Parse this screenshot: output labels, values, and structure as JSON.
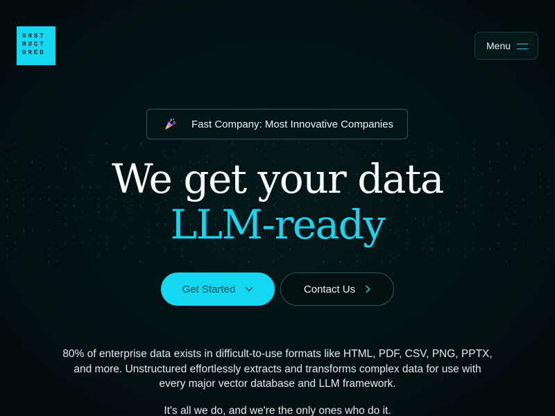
{
  "logo": {
    "lines": [
      "UNST",
      "RUCT",
      "URED"
    ]
  },
  "nav": {
    "menu_label": "Menu",
    "menu_icon": "hamburger-icon"
  },
  "announcement": {
    "icon": "party-popper-icon",
    "text": "Fast Company: Most Innovative Companies"
  },
  "hero": {
    "headline_line1": "We get your data",
    "headline_line2": "LLM-ready"
  },
  "actions": {
    "primary_label": "Get Started",
    "primary_icon": "chevron-down-icon",
    "secondary_label": "Contact Us",
    "secondary_icon": "chevron-right-icon"
  },
  "body": {
    "description": "80% of enterprise data exists in difficult-to-use formats like HTML, PDF, CSV, PNG, PPTX, and more. Unstructured effortlessly extracts and transforms complex data for use with every major vector database and LLM framework.",
    "tagline": "It's all we do, and we're the only ones who do it."
  },
  "colors": {
    "background": "#021010",
    "accent": "#14d7f2",
    "headline_white": "#f7fbfb",
    "border": "#2a5a60"
  }
}
